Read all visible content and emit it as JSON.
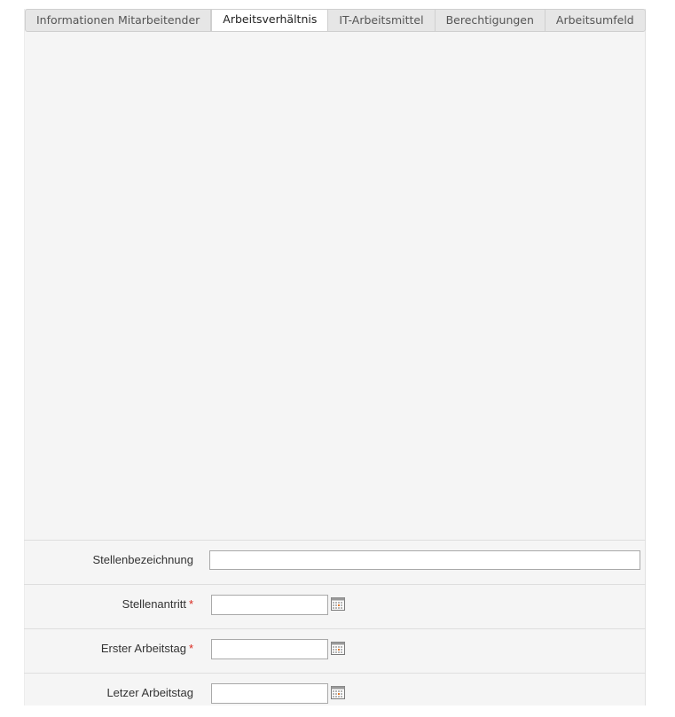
{
  "tabs": [
    {
      "label": "Informationen Mitarbeitender",
      "active": false
    },
    {
      "label": "Arbeitsverhältnis",
      "active": true
    },
    {
      "label": "IT-Arbeitsmittel",
      "active": false
    },
    {
      "label": "Berechtigungen",
      "active": false
    },
    {
      "label": "Arbeitsumfeld",
      "active": false
    }
  ],
  "form": {
    "job_title": {
      "label": "Stellenbezeichnung",
      "value": ""
    },
    "job_start": {
      "label": "Stellenantritt",
      "required_mark": "*",
      "value": ""
    },
    "first_workday": {
      "label": "Erster Arbeitstag",
      "required_mark": "*",
      "value": ""
    },
    "last_workday": {
      "label": "Letzer Arbeitstag",
      "value": ""
    }
  },
  "colors": {
    "panel_bg": "#f5f5f5",
    "required": "#d9261c",
    "border": "#a9a9a9"
  },
  "icons": {
    "date_picker": "calendar-icon"
  }
}
